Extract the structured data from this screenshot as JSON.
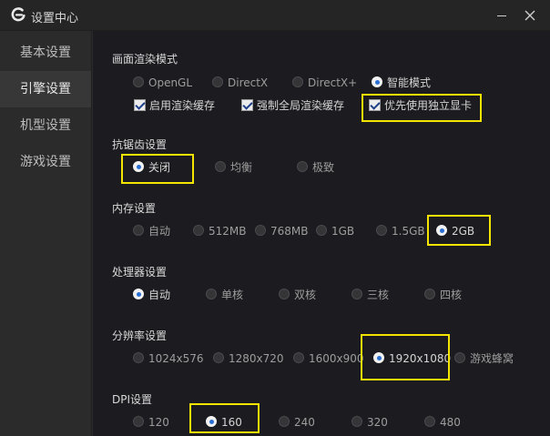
{
  "window": {
    "title": "设置中心"
  },
  "sidebar": {
    "items": [
      {
        "label": "基本设置"
      },
      {
        "label": "引擎设置"
      },
      {
        "label": "机型设置"
      },
      {
        "label": "游戏设置"
      }
    ],
    "active_index": 1
  },
  "render": {
    "title": "画面渲染模式",
    "options": [
      "OpenGL",
      "DirectX",
      "DirectX+",
      "智能模式"
    ],
    "selected": "智能模式",
    "checks": [
      {
        "label": "启用渲染缓存",
        "checked": true
      },
      {
        "label": "强制全局渲染缓存",
        "checked": true
      },
      {
        "label": "优先使用独立显卡",
        "checked": true
      }
    ]
  },
  "antialias": {
    "title": "抗锯齿设置",
    "options": [
      "关闭",
      "均衡",
      "极致"
    ],
    "selected": "关闭"
  },
  "memory": {
    "title": "内存设置",
    "options": [
      "自动",
      "512MB",
      "768MB",
      "1GB",
      "1.5GB",
      "2GB"
    ],
    "selected": "2GB"
  },
  "cpu": {
    "title": "处理器设置",
    "options": [
      "自动",
      "单核",
      "双核",
      "三核",
      "四核"
    ],
    "selected": "自动"
  },
  "resolution": {
    "title": "分辨率设置",
    "options": [
      "1024x576",
      "1280x720",
      "1600x900",
      "1920x1080",
      "游戏蜂窝"
    ],
    "selected": "1920x1080"
  },
  "dpi": {
    "title": "DPI设置",
    "options": [
      "120",
      "160",
      "240",
      "320",
      "480"
    ],
    "selected": "160"
  },
  "colors": {
    "highlight": "#f4e500",
    "radio_dot": "#2a6fd4",
    "sidebar_active": "#373738",
    "content_bg": "#1c1c20"
  },
  "icons": {
    "logo": "swirl-logo-icon",
    "minimize": "minimize-icon",
    "close": "close-icon"
  }
}
